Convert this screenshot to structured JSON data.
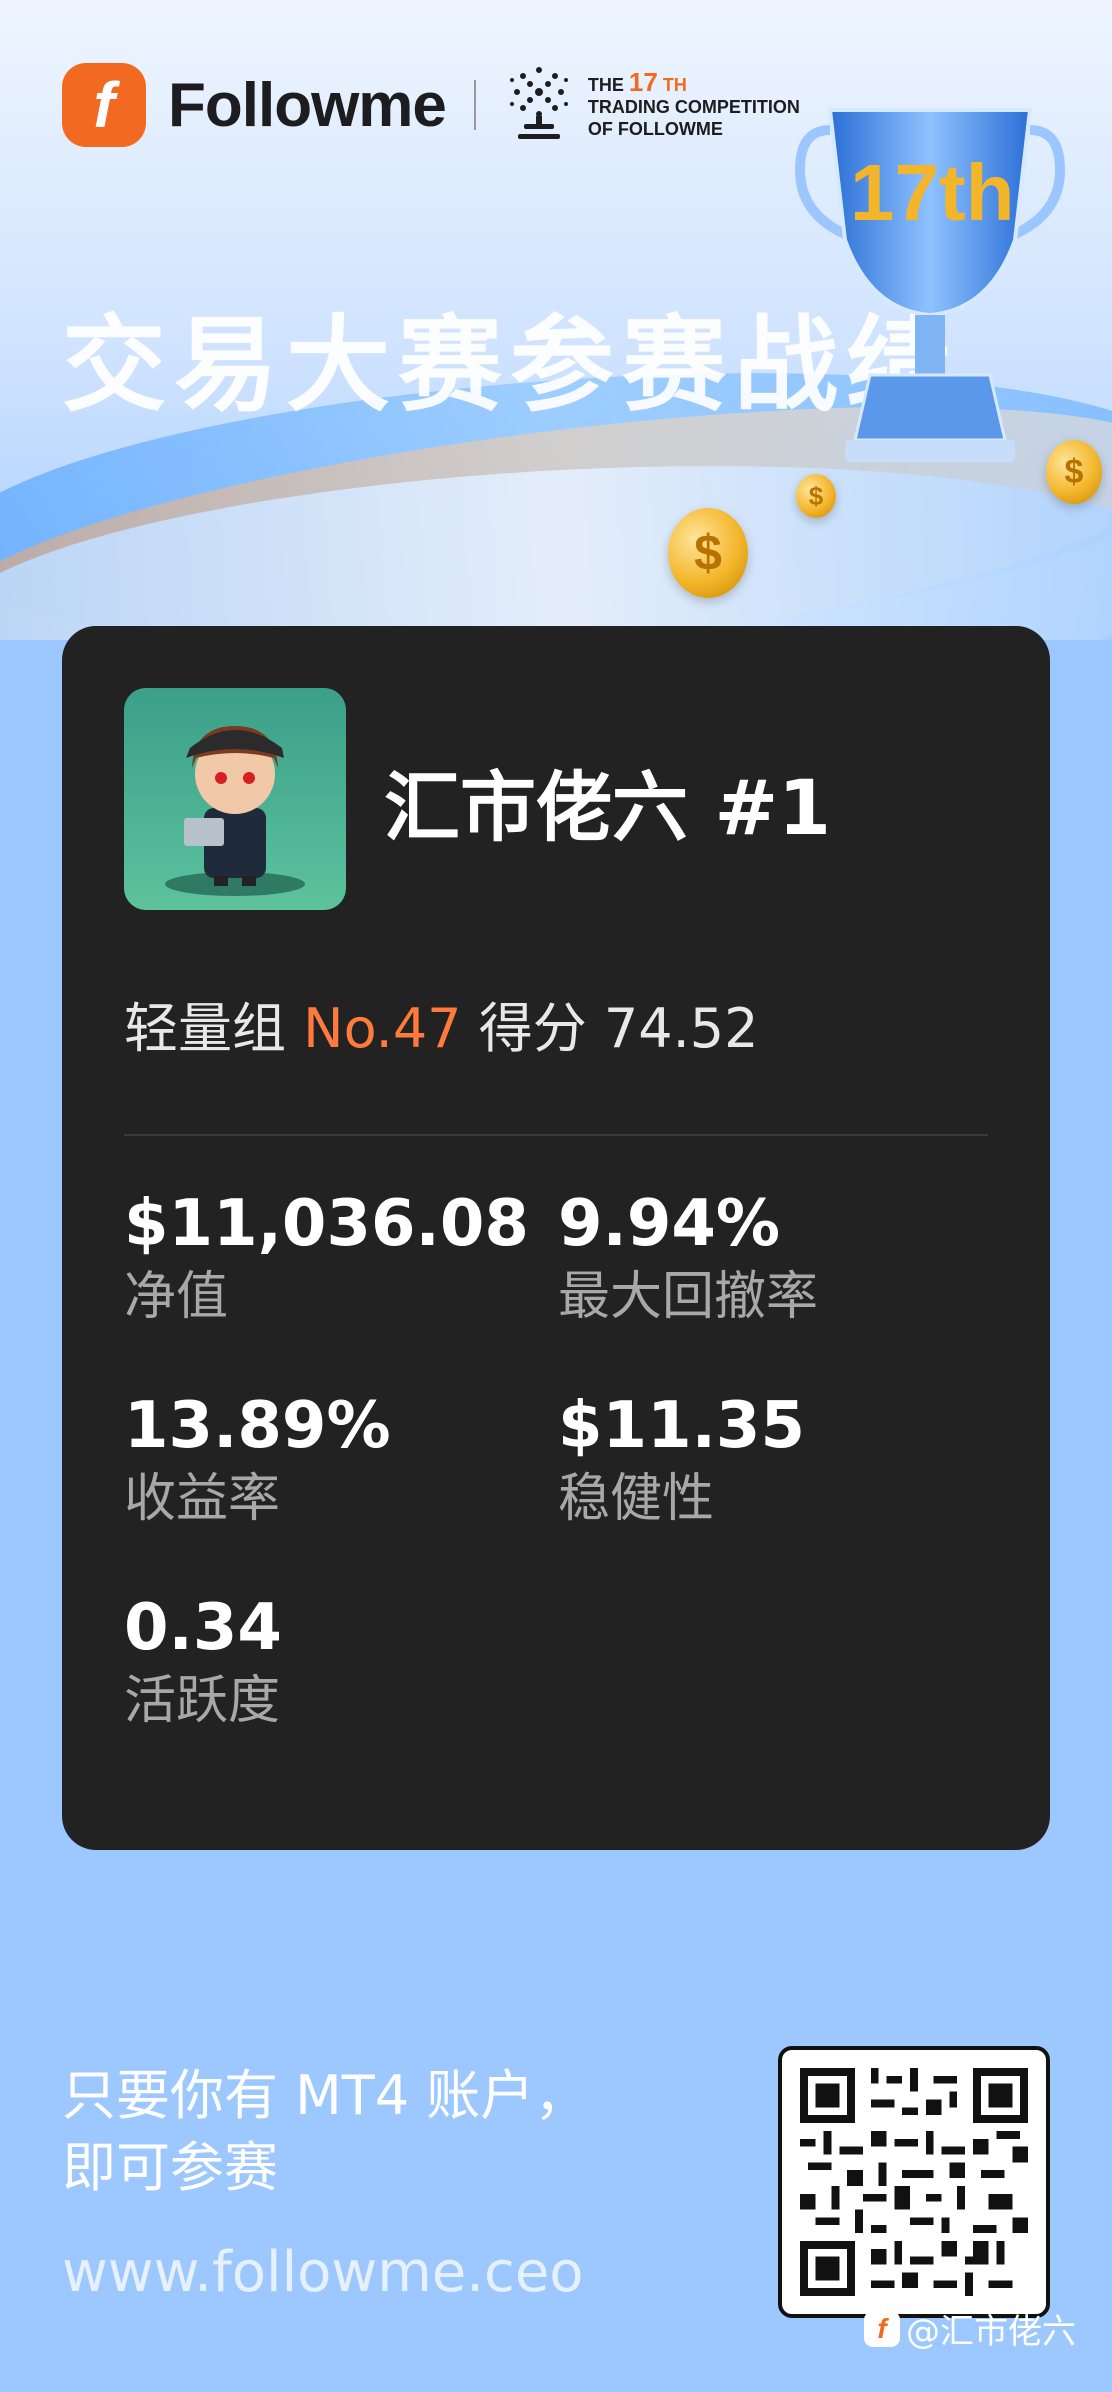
{
  "header": {
    "brand": "Followme",
    "competition_line1_prefix": "THE",
    "competition_number": "17",
    "competition_suffix": "TH",
    "competition_line2": "TRADING COMPETITION",
    "competition_line3": "OF FOLLOWME",
    "hero_title": "交易大赛参赛战绩",
    "trophy_label": "17th"
  },
  "card": {
    "user_name": "汇市佬六 #1",
    "group": "轻量组",
    "rank": "No.47",
    "score_label": "得分",
    "score_value": "74.52",
    "stats": [
      {
        "value": "$11,036.08",
        "label": "净值"
      },
      {
        "value": "9.94%",
        "label": "最大回撤率"
      },
      {
        "value": "13.89%",
        "label": "收益率"
      },
      {
        "value": "$11.35",
        "label": "稳健性"
      },
      {
        "value": "0.34",
        "label": "活跃度"
      }
    ]
  },
  "footer": {
    "cta_line1": "只要你有 MT4 账户，",
    "cta_line2": "即可参赛",
    "website": "www.followme.ceo",
    "watermark": "@汇市佬六"
  },
  "colors": {
    "accent": "#f26a21",
    "rank_highlight": "#ff7a3d",
    "card_bg": "#222222",
    "page_bg": "#9cc8ff"
  }
}
